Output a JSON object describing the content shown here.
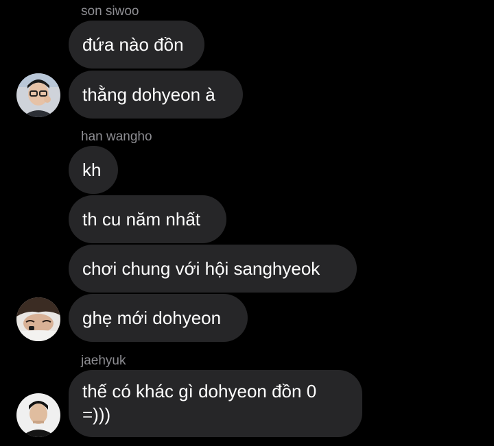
{
  "messages": [
    {
      "sender": "son siwoo",
      "lines": [
        "đứa nào đồn",
        "thằng dohyeon à"
      ]
    },
    {
      "sender": "han wangho",
      "lines": [
        "kh",
        "th cu năm nhất",
        "chơi chung với hội sanghyeok",
        "ghẹ mới dohyeon"
      ]
    },
    {
      "sender": "jaehyuk",
      "lines": [
        "thế có khác gì dohyeon đồn 0 =)))"
      ]
    }
  ],
  "colors": {
    "background": "#000000",
    "bubble": "#262628",
    "sender": "#8e8e93",
    "text": "#ffffff"
  }
}
